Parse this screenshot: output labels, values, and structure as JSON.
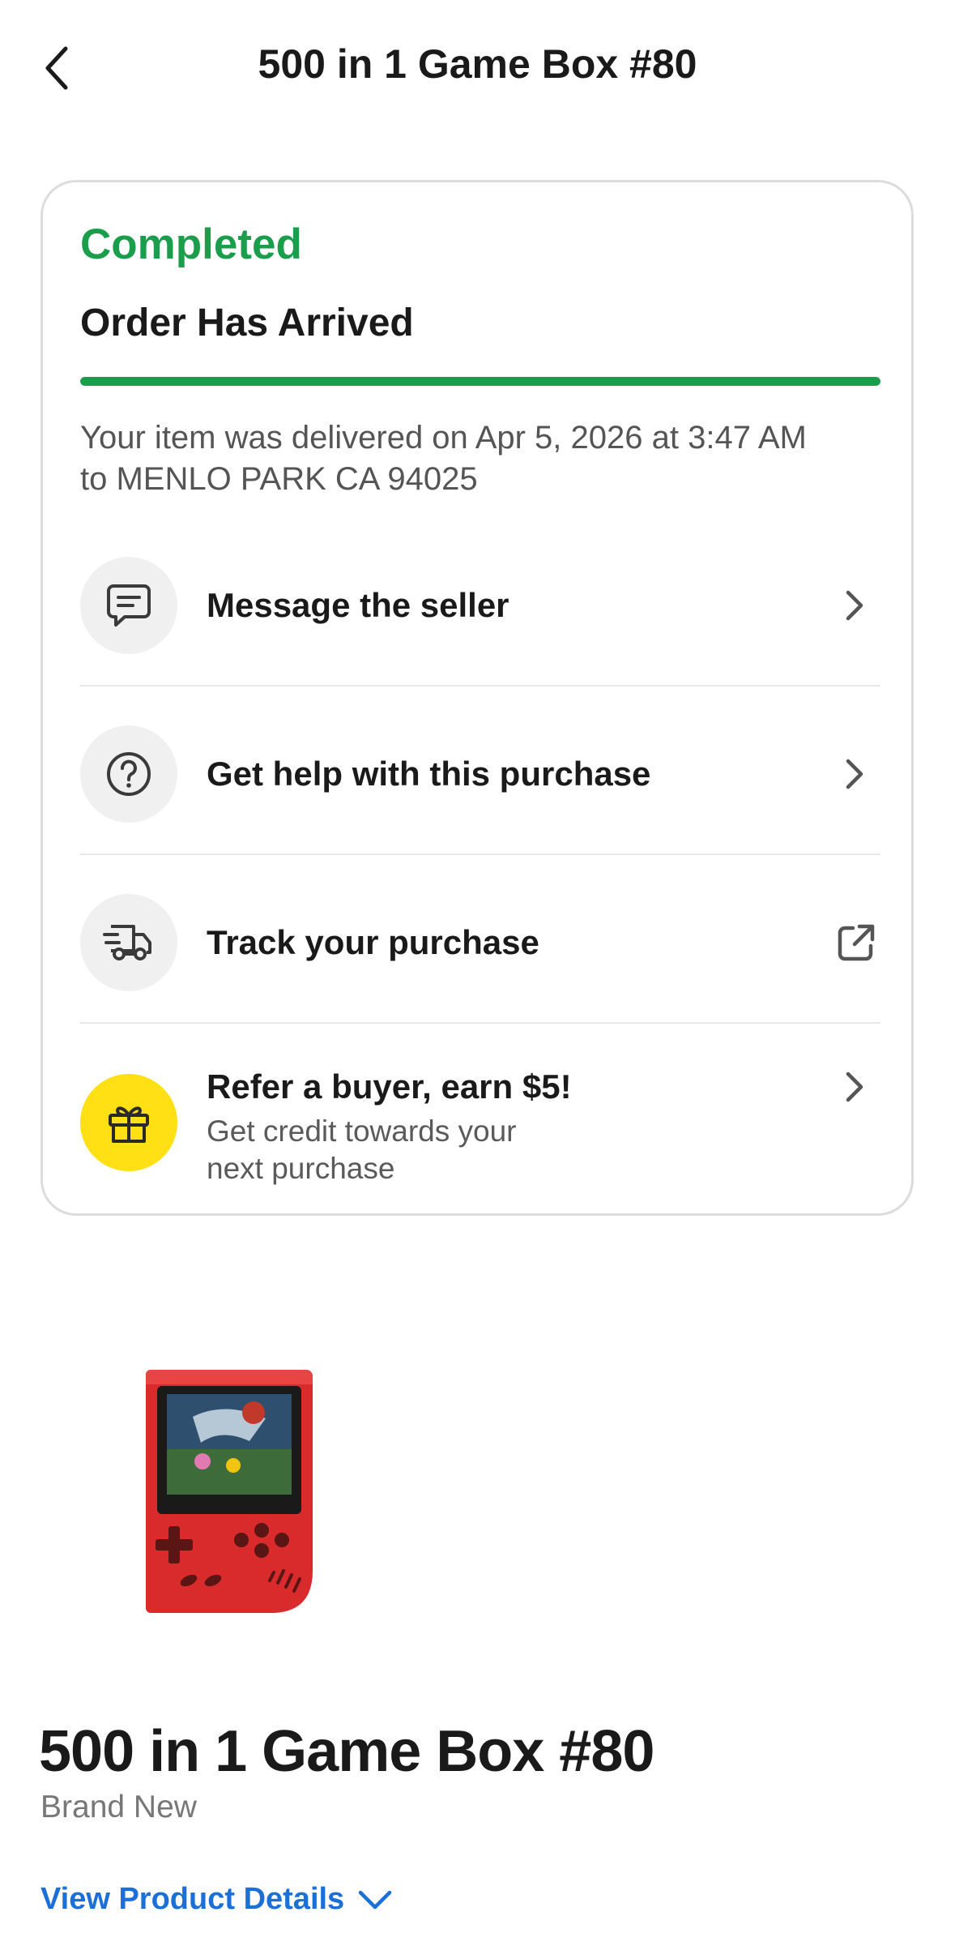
{
  "header": {
    "title": "500 in 1 Game Box #80"
  },
  "status_card": {
    "status": "Completed",
    "substatus": "Order Has Arrived",
    "progress": 1.0,
    "delivery_line1": "Your item was delivered on Apr 5, 2026 at 3:47 AM",
    "delivery_line2": "to MENLO PARK CA 94025",
    "colors": {
      "status_green": "#1a9e4b",
      "refer_yellow": "#ffe014"
    },
    "actions": [
      {
        "label": "Message the seller",
        "icon": "chat-bubble-icon",
        "trailing": "chevron-right-icon"
      },
      {
        "label": "Get help with this purchase",
        "icon": "help-circle-icon",
        "trailing": "chevron-right-icon"
      },
      {
        "label": "Track your purchase",
        "icon": "truck-icon",
        "trailing": "external-link-icon"
      }
    ],
    "referral": {
      "title": "Refer a buyer, earn $5!",
      "sub_line1": "Get credit towards your",
      "sub_line2": "next purchase",
      "icon": "gift-icon"
    }
  },
  "product": {
    "title": "500 in 1 Game Box #80",
    "condition": "Brand New",
    "details_link": "View Product Details",
    "image_icon": "handheld-game-console"
  }
}
